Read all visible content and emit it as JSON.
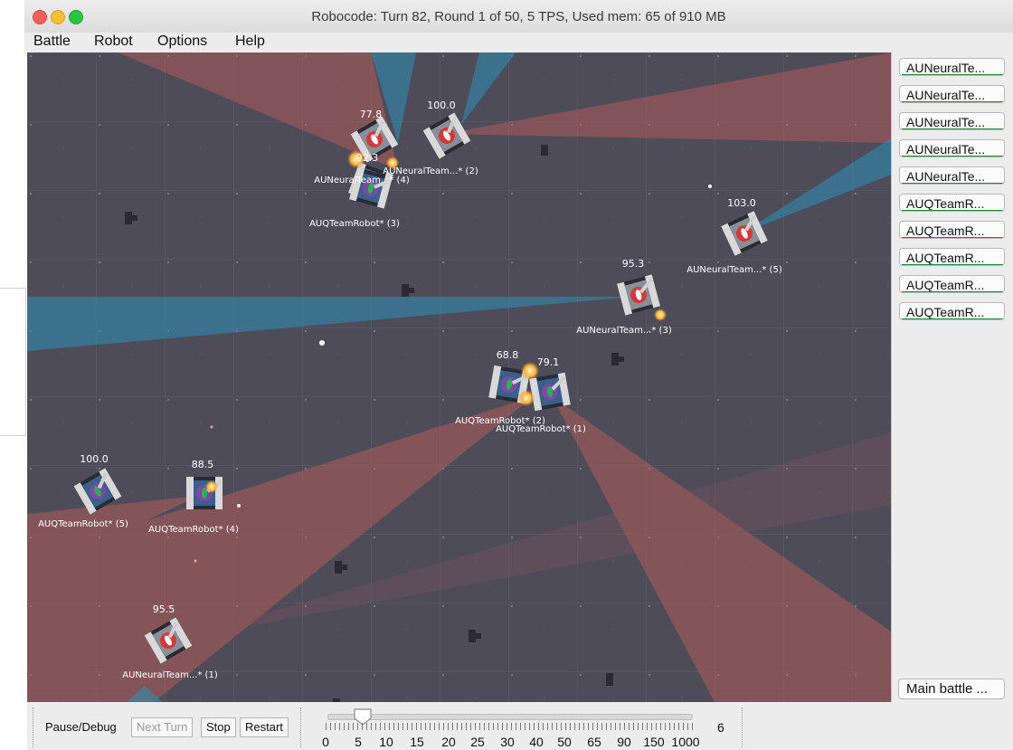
{
  "window": {
    "title": "Robocode: Turn 82, Round 1 of 50, 5 TPS, Used mem: 65 of 910 MB"
  },
  "menu": [
    "Battle",
    "Robot",
    "Options",
    "Help"
  ],
  "colors": {
    "field_bg": "#4c4a57",
    "scan_red": "#c4605a",
    "scan_blue": "#2b8fb8",
    "list_bar_green": "#1d8a3a"
  },
  "robot_list": [
    "AUNeuralTe...",
    "AUNeuralTe...",
    "AUNeuralTe...",
    "AUNeuralTe...",
    "AUNeuralTe...",
    "AUQTeamR...",
    "AUQTeamR...",
    "AUQTeamR...",
    "AUQTeamR...",
    "AUQTeamR..."
  ],
  "main_battle_button": "Main battle ...",
  "robots": [
    {
      "energy": "77.8",
      "name": "",
      "team": "neural"
    },
    {
      "energy": "100.0",
      "name": "AUNeuralTeam...* (2)",
      "team": "neural"
    },
    {
      "energy": "92.3",
      "name": "AUNeuralTeam...* (4)",
      "team": "quantum"
    },
    {
      "energy": "",
      "name": "AUQTeamRobot* (3)",
      "team": "quantum"
    },
    {
      "energy": "103.0",
      "name": "AUNeuralTeam...* (5)",
      "team": "neural"
    },
    {
      "energy": "95.3",
      "name": "AUNeuralTeam...* (3)",
      "team": "neural"
    },
    {
      "energy": "68.8",
      "name": "AUQTeamRobot* (2)",
      "team": "quantum"
    },
    {
      "energy": "79.1",
      "name": "AUQTeamRobot* (1)",
      "team": "quantum"
    },
    {
      "energy": "100.0",
      "name": "AUQTeamRobot* (5)",
      "team": "quantum"
    },
    {
      "energy": "88.5",
      "name": "AUQTeamRobot* (4)",
      "team": "quantum"
    },
    {
      "energy": "95.5",
      "name": "AUNeuralTeam...* (1)",
      "team": "neural"
    }
  ],
  "controls": {
    "pause_label": "Pause/Debug",
    "next_turn": "Next Turn",
    "stop": "Stop",
    "restart": "Restart",
    "tps_ticks": [
      "0",
      "5",
      "10",
      "15",
      "20",
      "25",
      "30",
      "40",
      "50",
      "65",
      "90",
      "150",
      "1000"
    ],
    "tps_value": "6"
  }
}
